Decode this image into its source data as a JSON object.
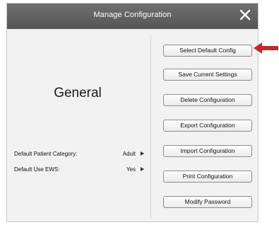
{
  "dialog": {
    "title": "Manage Configuration"
  },
  "left": {
    "heading": "General",
    "settings": [
      {
        "label": "Default Patient Category:",
        "value": "Adult"
      },
      {
        "label": "Default Use EWS:",
        "value": "Yes"
      }
    ]
  },
  "buttons": [
    {
      "label": "Select Default Config"
    },
    {
      "label": "Save Current Settings"
    },
    {
      "label": "Delete Configuration"
    },
    {
      "label": "Export Configuration"
    },
    {
      "label": "Import Configuration"
    },
    {
      "label": "Print Configuration"
    },
    {
      "label": "Modify Password"
    }
  ],
  "colors": {
    "titlebar": "#5f5f5f",
    "panel": "#f2f2f2",
    "annotation_arrow": "#c62828"
  },
  "icons": {
    "close": "close-icon",
    "chevron": "chevron-right-icon",
    "annotation": "red-arrow-icon"
  }
}
